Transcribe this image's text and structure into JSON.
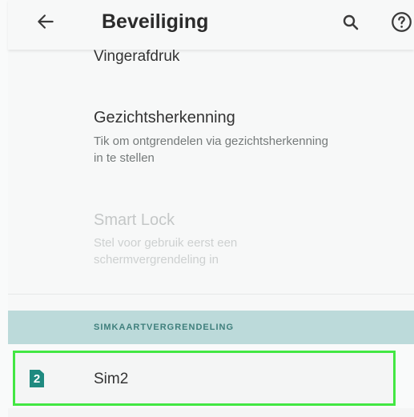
{
  "app_bar": {
    "title": "Beveiliging",
    "back_icon": "arrow-left-icon",
    "search_icon": "search-icon",
    "help_icon": "help-circle-icon"
  },
  "list": {
    "partial_item_title": "Vingerafdruk",
    "items": [
      {
        "title": "Gezichtsherkenning",
        "summary": "Tik om ontgrendelen via gezichtsherkenning in te stellen",
        "enabled": true
      },
      {
        "title": "Smart Lock",
        "summary": "Stel voor gebruik eerst een schermvergrendeling in",
        "enabled": false
      }
    ]
  },
  "sim_section": {
    "header": "SIMKAARTVERGRENDELING",
    "sim_icon_number": "2",
    "sim_label": "Sim2",
    "highlight_color": "#43e743"
  },
  "colors": {
    "accent": "#3f7f7c",
    "section_header_bg": "#bcdada",
    "sim_icon": "#1f8a80"
  }
}
